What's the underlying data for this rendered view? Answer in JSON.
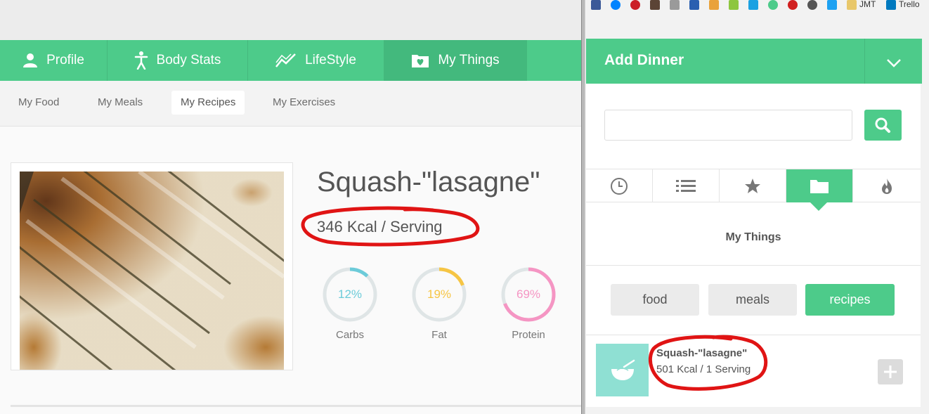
{
  "nav": {
    "tabs": [
      {
        "label": "Profile",
        "icon": "person-icon"
      },
      {
        "label": "Body Stats",
        "icon": "body-icon"
      },
      {
        "label": "LifeStyle",
        "icon": "trend-icon"
      },
      {
        "label": "My Things",
        "icon": "folder-heart-icon",
        "active": true
      }
    ]
  },
  "subnav": {
    "items": [
      {
        "label": "My Food"
      },
      {
        "label": "My Meals"
      },
      {
        "label": "My Recipes",
        "active": true
      },
      {
        "label": "My Exercises"
      }
    ]
  },
  "recipe": {
    "title": "Squash-\"lasagne\"",
    "kcal": "346 Kcal / Serving",
    "macros": [
      {
        "pct": "12%",
        "label": "Carbs",
        "value": 0.12,
        "color": "#6ccbd9"
      },
      {
        "pct": "19%",
        "label": "Fat",
        "value": 0.19,
        "color": "#f6c544"
      },
      {
        "pct": "69%",
        "label": "Protein",
        "value": 0.69,
        "color": "#f595c3"
      }
    ]
  },
  "bookmarks": {
    "jmt": "JMT",
    "trello": "Trello"
  },
  "panel": {
    "title": "Add Dinner",
    "search_value": "",
    "section_title": "My Things",
    "filters": [
      {
        "label": "food"
      },
      {
        "label": "meals"
      },
      {
        "label": "recipes",
        "active": true
      }
    ],
    "result": {
      "name": "Squash-\"lasagne\"",
      "kcal": "501 Kcal / 1 Serving"
    }
  },
  "colors": {
    "brand_green": "#4dcb8a",
    "annotation_red": "#e01414"
  }
}
